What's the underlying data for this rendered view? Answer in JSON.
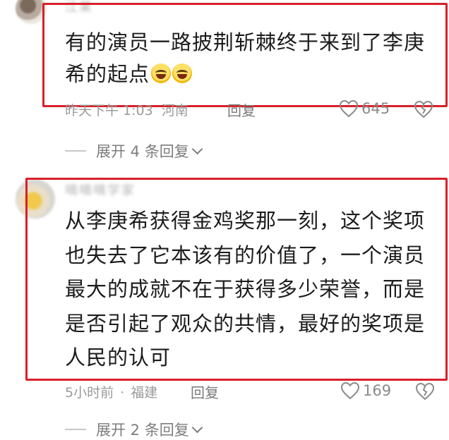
{
  "comments": [
    {
      "username": "江某",
      "text": "有的演员一路披荆斩棘终于来到了李庚希的起点",
      "emoji_count": 2,
      "time": "昨天下午 1:03",
      "location": "河南",
      "reply_label": "回复",
      "likes": "645",
      "expand_label": "展开 4 条回复"
    },
    {
      "username": "嘀嘀嘀学家",
      "text": "从李庚希获得金鸡奖那一刻，这个奖项也失去了它本该有的价值了，一个演员最大的成就不在于获得多少荣誉，而是是否引起了观众的共情，最好的奖项是人民的认可",
      "time": "5小时前",
      "location": "福建",
      "reply_label": "回复",
      "likes": "169",
      "expand_label": "展开 2 条回复"
    }
  ],
  "colors": {
    "highlight": "#d8202a",
    "meta_text": "#9a9a9a",
    "body_text": "#1c1c1c"
  },
  "icons": {
    "like": "heart-icon",
    "dislike": "broken-heart-icon",
    "expand": "chevron-down-icon",
    "emoji": "grinning-sweat-emoji-icon"
  }
}
